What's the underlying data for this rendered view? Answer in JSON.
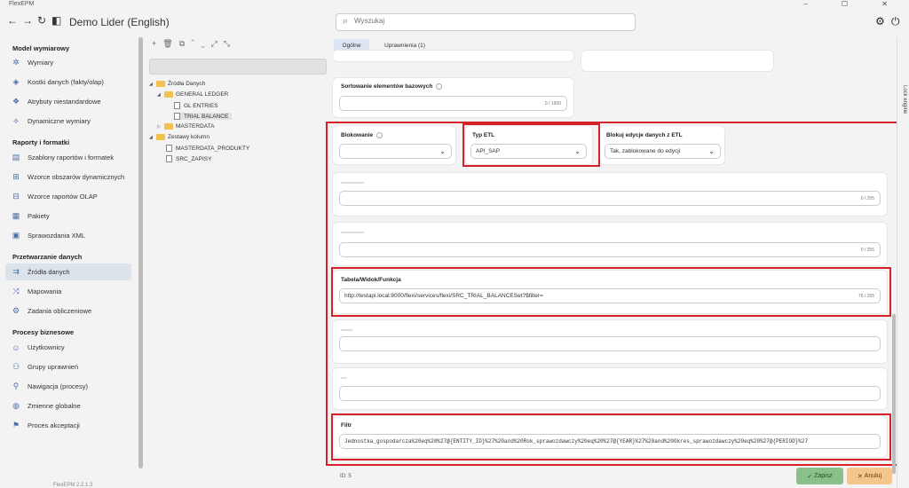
{
  "window": {
    "app_name": "FlexEPM"
  },
  "toolbar": {
    "title": "Demo Lider (English)",
    "search_placeholder": "Wyszukaj"
  },
  "sidebar": {
    "sections": [
      {
        "title": "Model wymiarowy",
        "items": [
          "Wymiary",
          "Kostki danych (fakty/olap)",
          "Atrybuty niestandardowe",
          "Dynamiczne wymiary"
        ]
      },
      {
        "title": "Raporty i formatki",
        "items": [
          "Szablony raportów i formatek",
          "Wzorce obszarów dynamicznych",
          "Wzorce raportów OLAP",
          "Pakiety",
          "Sprawozdania XML"
        ]
      },
      {
        "title": "Przetwarzanie danych",
        "items": [
          "Źródła danych",
          "Mapowania",
          "Zadania obliczeniowe"
        ]
      },
      {
        "title": "Procesy biznesowe",
        "items": [
          "Użytkownicy",
          "Grupy uprawnień",
          "Nawigacja (procesy)",
          "Zmienne globalne",
          "Proces akceptacji"
        ]
      }
    ],
    "active_item": "Źródła danych",
    "version": "FlexEPM 2.2.1.3"
  },
  "tree": {
    "nodes": [
      {
        "label": "Źródła Danych",
        "type": "folder",
        "level": 0,
        "expanded": true
      },
      {
        "label": "GENERAL LEDGER",
        "type": "folder",
        "level": 1,
        "expanded": true
      },
      {
        "label": "GL ENTRIES",
        "type": "doc",
        "level": 2
      },
      {
        "label": "TRIAL BALANCE",
        "type": "doc",
        "level": 2,
        "selected": true
      },
      {
        "label": "MASTERDATA",
        "type": "folder",
        "level": 1,
        "expanded": false
      },
      {
        "label": "Zestawy kolumn",
        "type": "folder",
        "level": 0,
        "expanded": true
      },
      {
        "label": "MASTERDATA_PRODUKTY",
        "type": "doc",
        "level": 1
      },
      {
        "label": "SRC_ZAPISY",
        "type": "doc",
        "level": 1
      }
    ]
  },
  "tabs": [
    "Ogólne",
    "Uprawnienia (1)"
  ],
  "form": {
    "sort_label": "Sortowanie elementów bazowych",
    "sort_count": "0 / 1500",
    "blokowanie_label": "Blokowanie",
    "typ_etl_label": "Typ ETL",
    "typ_etl_value": "API_SAP",
    "blokuj_label": "Blokuj edycje danych z ETL",
    "blokuj_value": "Tak, zablokowane do edycji",
    "blurred1_count": "0 / 255",
    "blurred2_count": "0 / 255",
    "tabela_label": "Tabela/Widok/Funkcja",
    "tabela_value": "http://testapi.local:8000/flexi/services/flexi/SRC_TRIAL_BALANCESet?$filter=",
    "tabela_count": "76 / 255",
    "filtr_label": "Filtr",
    "filtr_value": "Jednostka_gospodarcza%20eq%20%27@{ENTITY_ID}%27%20and%20Rok_sprawozdawczy%20eq%20%27@{YEAR}%27%20and%20Okres_sprawozdawczy%20eq%20%27@{PERIOD}%27"
  },
  "footer": {
    "id_label": "ID: 5",
    "save": "Zapisz",
    "cancel": "Anuluj"
  },
  "right_strip": {
    "label": "Lock engine"
  },
  "colors": {
    "accent": "#4a6fa5",
    "highlight": "#d6202a",
    "save": "#8cc08a",
    "cancel": "#f4c58d"
  }
}
